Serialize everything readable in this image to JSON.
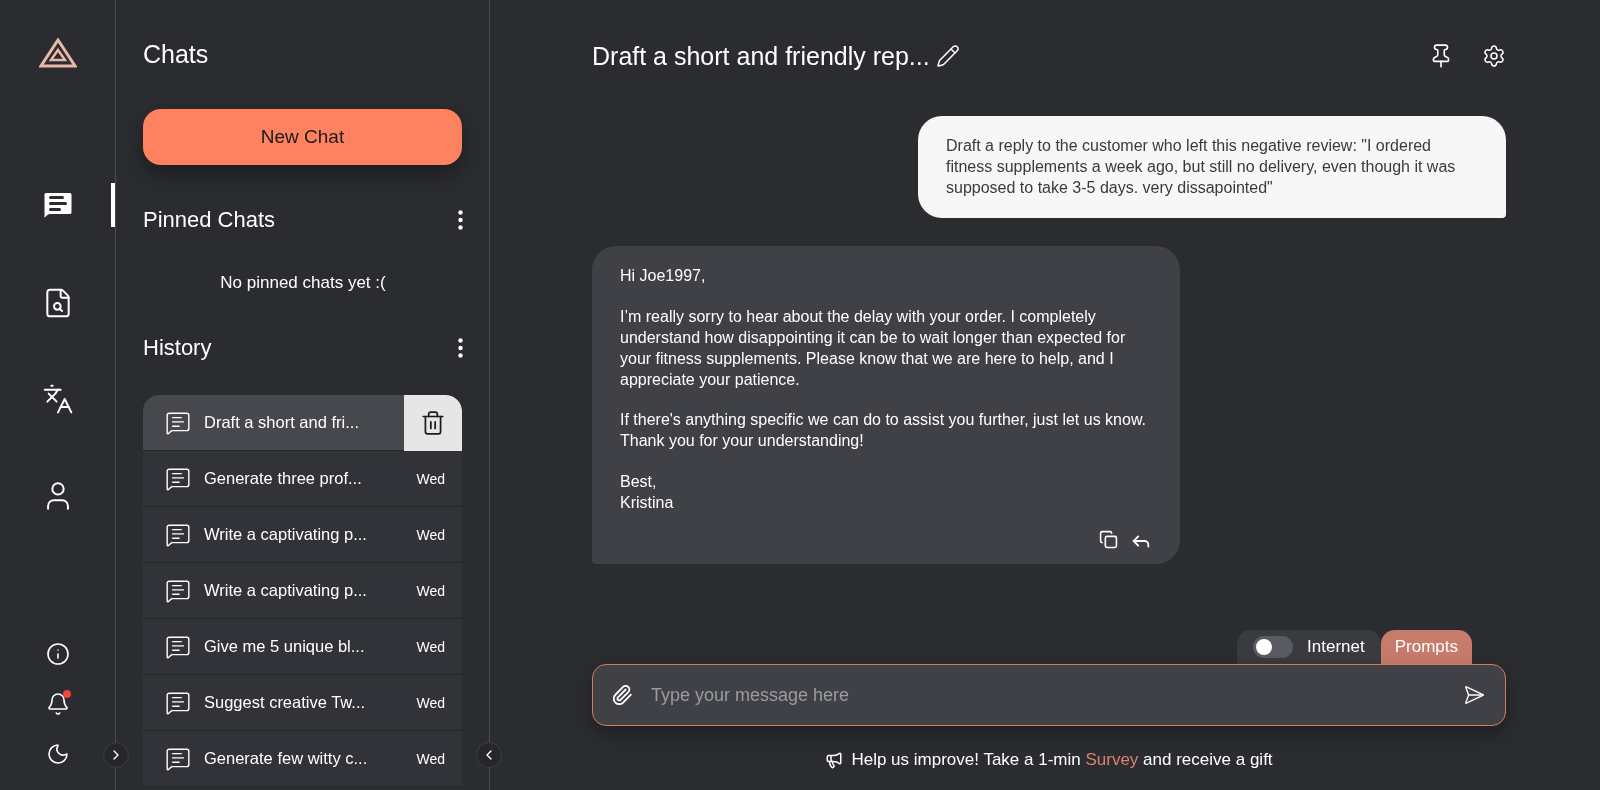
{
  "rail": {
    "items": [
      {
        "selected": true
      },
      {
        "selected": false
      },
      {
        "selected": false
      },
      {
        "selected": false
      }
    ],
    "bottom": [
      {
        "unread": false
      },
      {
        "unread": true
      },
      {
        "unread": false
      }
    ]
  },
  "sidebar": {
    "title": "Chats",
    "new_chat": "New Chat",
    "pinned": {
      "title": "Pinned Chats",
      "empty": "No pinned chats yet :("
    },
    "history": {
      "title": "History",
      "items": [
        {
          "title": "Draft a short and fri...",
          "selected": true
        },
        {
          "title": "Generate three prof...",
          "date": "Wed",
          "selected": false
        },
        {
          "title": "Write a captivating p...",
          "date": "Wed",
          "selected": false
        },
        {
          "title": "Write a captivating p...",
          "date": "Wed",
          "selected": false
        },
        {
          "title": "Give me 5 unique bl...",
          "date": "Wed",
          "selected": false
        },
        {
          "title": "Suggest creative Tw...",
          "date": "Wed",
          "selected": false
        },
        {
          "title": "Generate few witty c...",
          "date": "Wed",
          "selected": false
        }
      ]
    }
  },
  "chat": {
    "title": "Draft a short and friendly rep...",
    "messages": [
      {
        "kind": "sent",
        "paragraphs": [
          "Draft a reply to the customer who left this negative review: \"I ordered fitness supplements a week ago, but still no delivery, even though it was supposed to take 3-5 days. very dissapointed\""
        ]
      },
      {
        "kind": "received",
        "paragraphs": [
          "Hi Joe1997,",
          "I’m really sorry to hear about the delay with your order. I completely understand how disappointing it can be to wait longer than expected for your fitness supplements. Please know that we are here to help, and I appreciate your patience.",
          "If there's anything specific we can do to assist you further, just let us know. Thank you for your understanding!",
          "Best,\nKristina"
        ]
      }
    ],
    "internet": {
      "label": "Internet",
      "on": false
    },
    "prompts": "Prompts",
    "input": {
      "placeholder": "Type your message here"
    },
    "survey": {
      "before": "Help us improve! Take a 1-min",
      "link": "Survey",
      "after": "and receive a gift"
    }
  }
}
